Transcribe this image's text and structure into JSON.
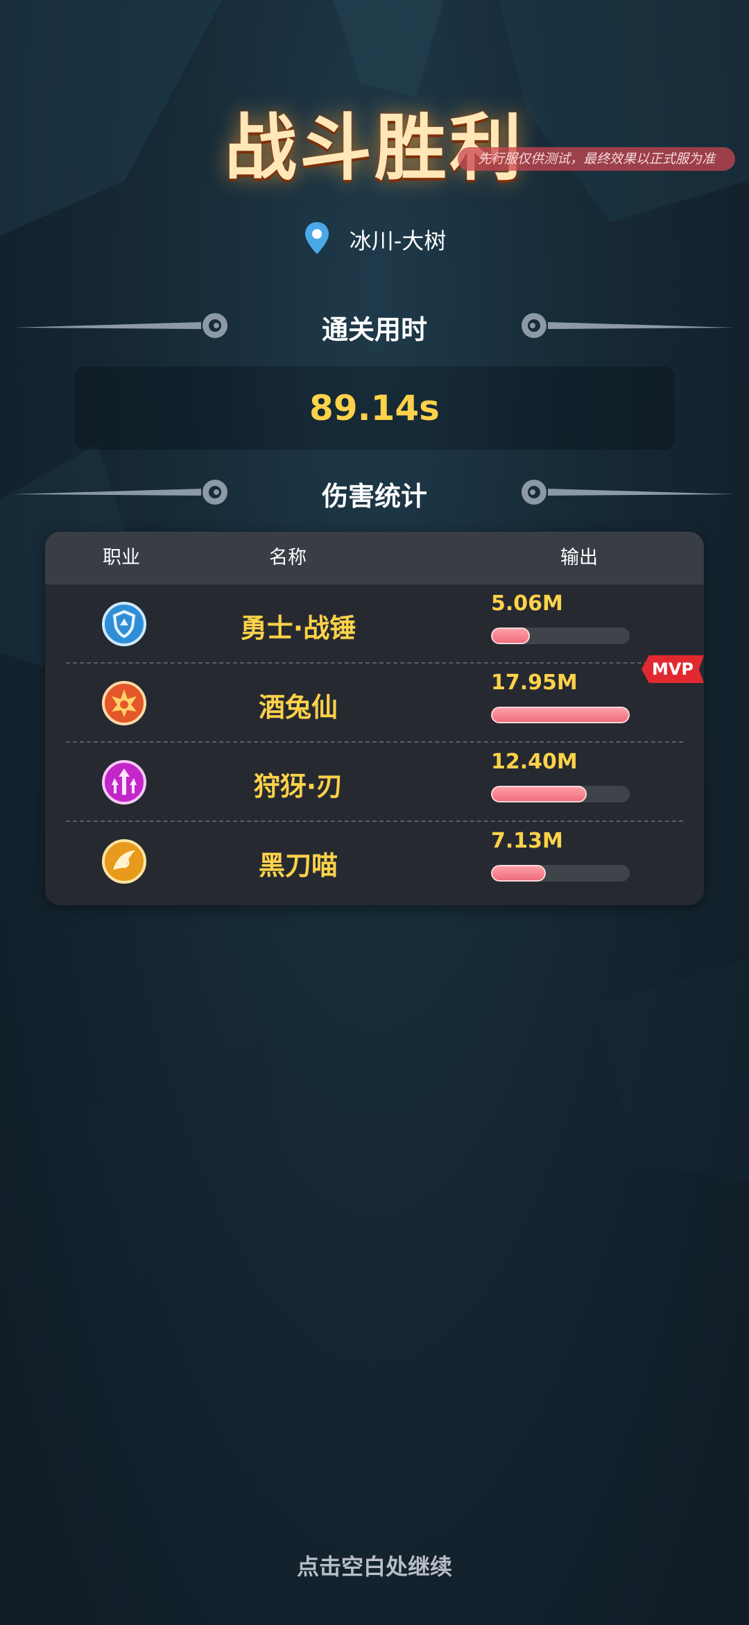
{
  "title": "战斗胜利",
  "notice": "先行服仅供测试，最终效果以正式服为准",
  "location": "冰川-大树",
  "sections": {
    "time_label": "通关用时",
    "damage_label": "伤害统计"
  },
  "clear_time": "89.14s",
  "table": {
    "headers": {
      "class": "职业",
      "name": "名称",
      "output": "输出"
    },
    "rows": [
      {
        "name": "勇士·战锤",
        "value": "5.06M",
        "fraction": 0.282,
        "icon": "shield-class-icon",
        "icon_color": "#2f8fd6"
      },
      {
        "name": "酒兔仙",
        "value": "17.95M",
        "fraction": 1.0,
        "icon": "flame-class-icon",
        "icon_color": "#e4572a",
        "mvp": "MVP"
      },
      {
        "name": "狩犽·刃",
        "value": "12.40M",
        "fraction": 0.691,
        "icon": "arrows-class-icon",
        "icon_color": "#c326c9"
      },
      {
        "name": "黑刀喵",
        "value": "7.13M",
        "fraction": 0.397,
        "icon": "blade-class-icon",
        "icon_color": "#e89a1c"
      }
    ]
  },
  "footer": "点击空白处继续",
  "colors": {
    "accent_gold": "#ffd24a",
    "bar_fill": "#ee6d7a",
    "mvp": "#e02a30",
    "panel": "#262a30"
  }
}
